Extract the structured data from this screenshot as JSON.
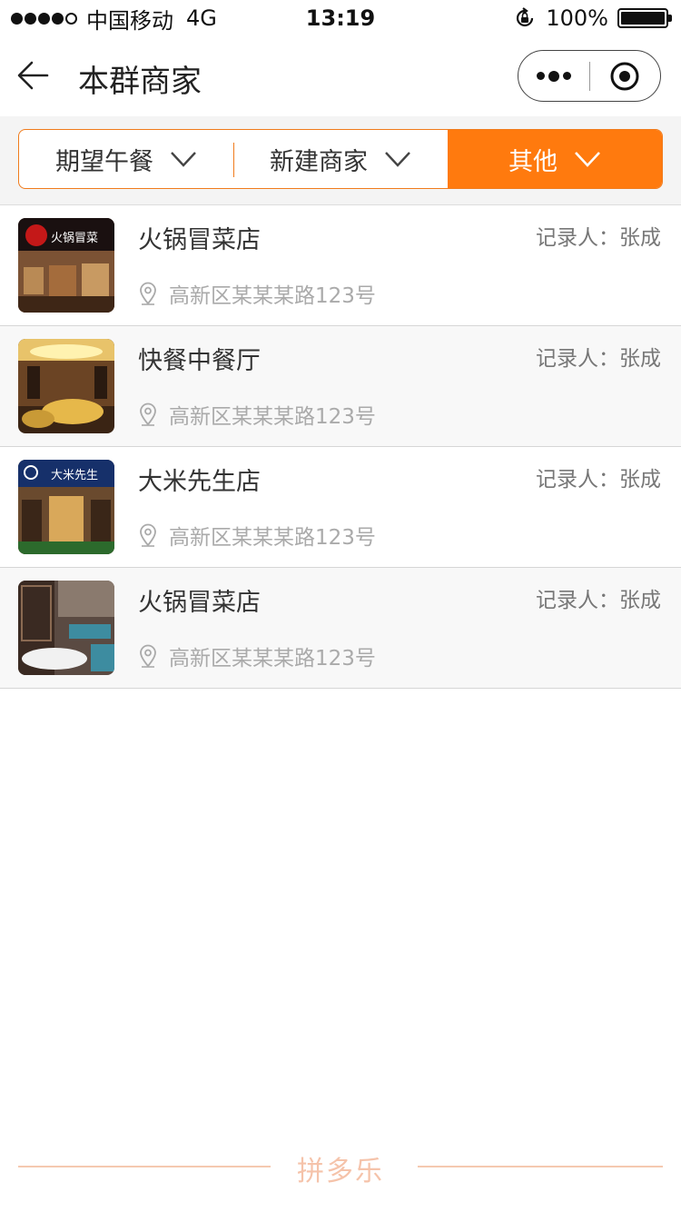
{
  "status_bar": {
    "carrier": "中国移动",
    "network": "4G",
    "time": "13:19",
    "battery": "100%",
    "signal_dots_filled": 4,
    "signal_dots_total": 5
  },
  "nav": {
    "title": "本群商家",
    "back_icon": "back-arrow-icon",
    "more_icon": "more-dots-icon",
    "close_icon": "target-circle-icon"
  },
  "filters": {
    "tabs": [
      {
        "label": "期望午餐",
        "active": false
      },
      {
        "label": "新建商家",
        "active": false
      },
      {
        "label": "其他",
        "active": true
      }
    ],
    "accent": "#ff7a0e"
  },
  "merchants": [
    {
      "name": "火锅冒菜店",
      "recorder": "记录人：张成",
      "address": "高新区某某某路123号",
      "sign": "火锅冒菜"
    },
    {
      "name": "快餐中餐厅",
      "recorder": "记录人：张成",
      "address": "高新区某某某路123号",
      "sign": ""
    },
    {
      "name": "大米先生店",
      "recorder": "记录人：张成",
      "address": "高新区某某某路123号",
      "sign": "大米先生"
    },
    {
      "name": "火锅冒菜店",
      "recorder": "记录人：张成",
      "address": "高新区某某某路123号",
      "sign": ""
    }
  ],
  "footer": {
    "brand": "拼多乐"
  }
}
